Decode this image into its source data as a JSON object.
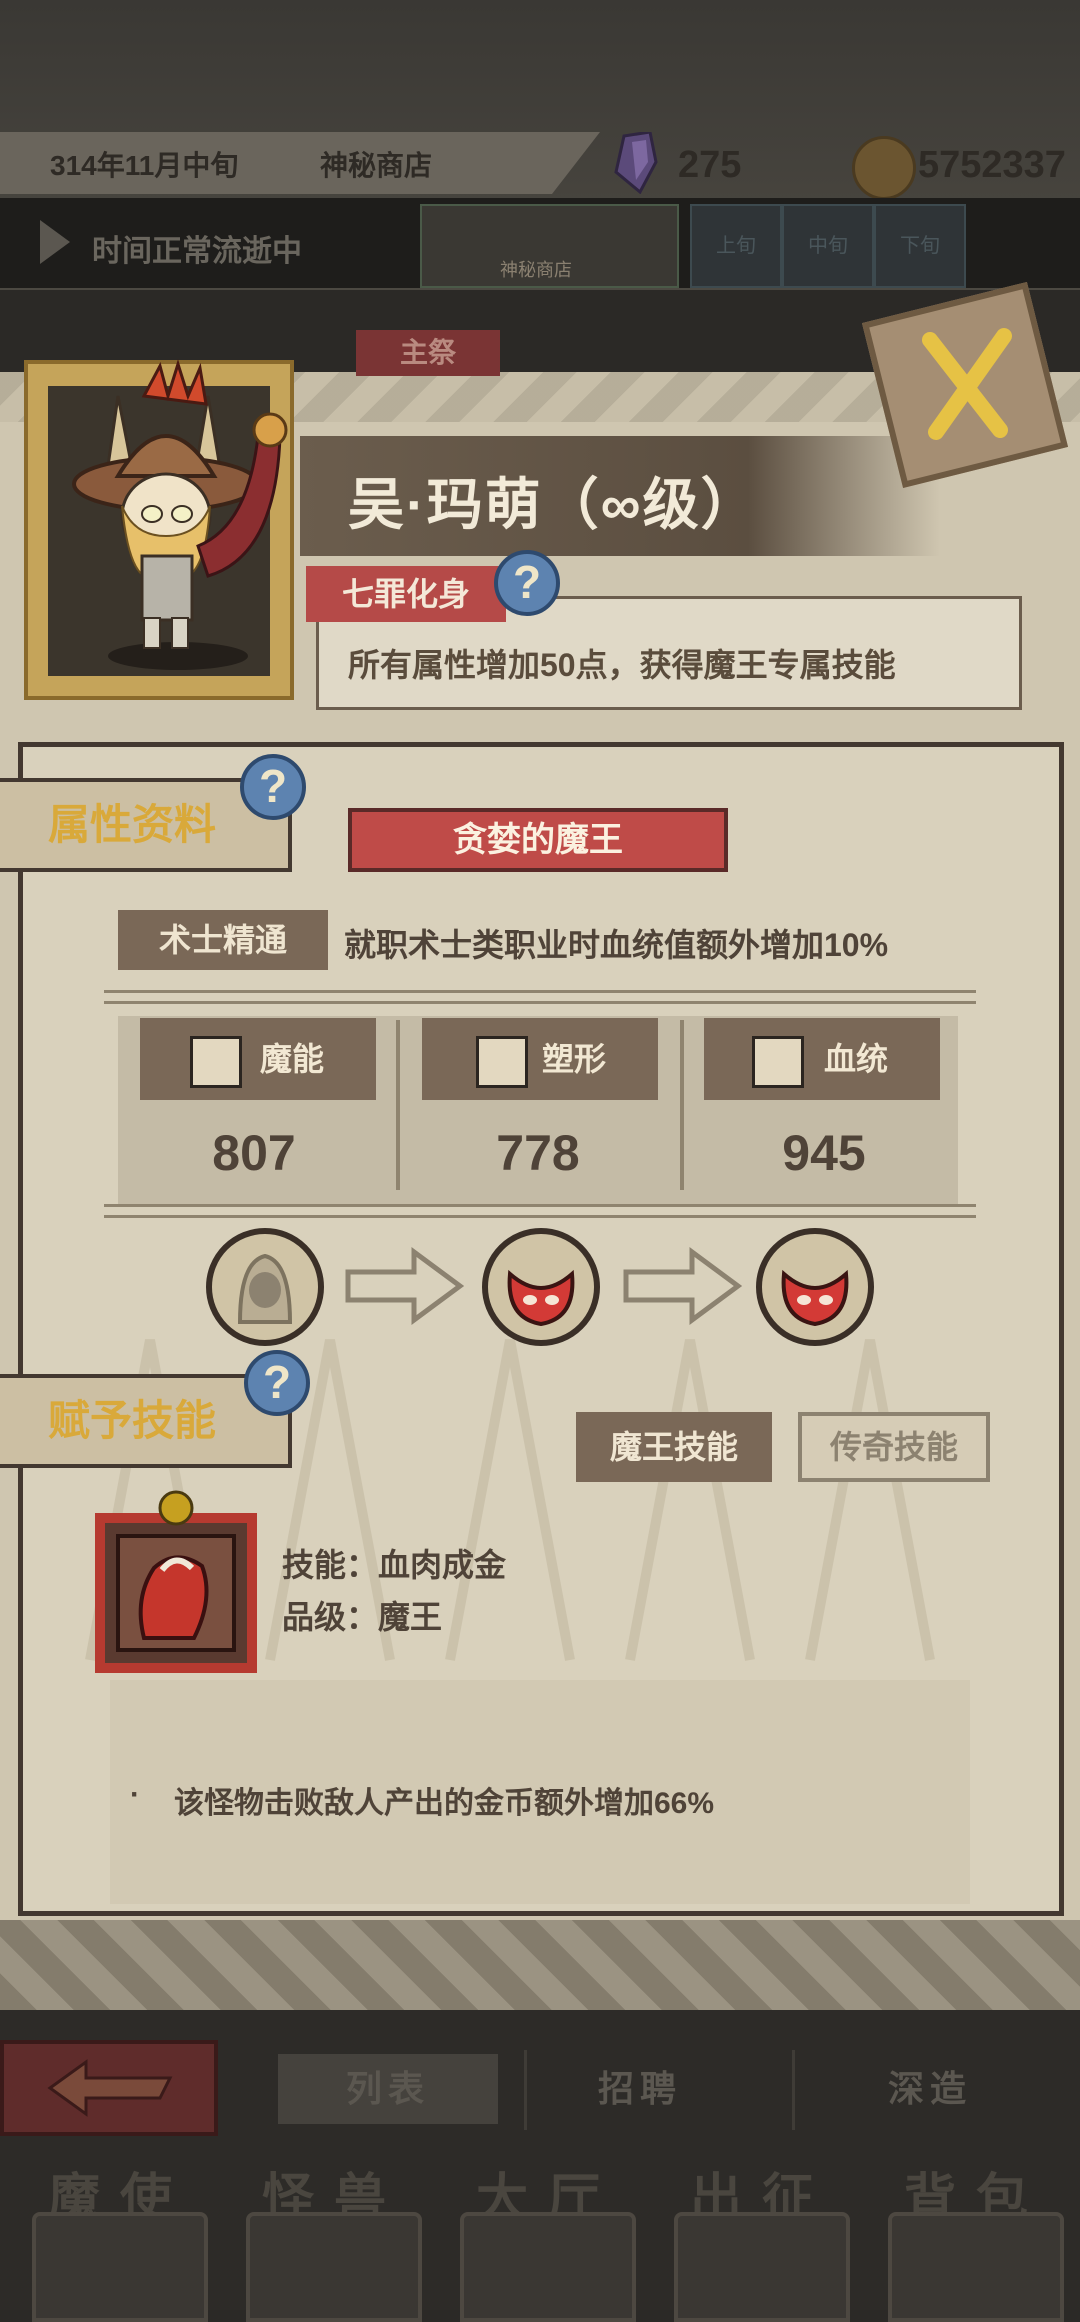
{
  "status_bar": {
    "date": "314年11月中旬",
    "location": "神秘商店",
    "gems": "275",
    "gold": "5752337",
    "time_status": "时间正常流逝中",
    "thumbnail_label": "神秘商店",
    "periods": [
      "上旬",
      "中旬",
      "下旬"
    ]
  },
  "tag_main": "主祭",
  "character": {
    "name": "吴·玛萌（∞级）",
    "sin_title": "七罪化身",
    "sin_description": "所有属性增加50点，获得魔王专属技能"
  },
  "attributes": {
    "section_title": "属性资料",
    "class_title": "贪婪的魔王",
    "trait_name": "术士精通",
    "trait_description": "就职术士类职业时血统值额外增加10%",
    "stats": [
      {
        "label": "魔能",
        "value": "807",
        "icon": "magic-icon"
      },
      {
        "label": "塑形",
        "value": "778",
        "icon": "shape-icon"
      },
      {
        "label": "血统",
        "value": "945",
        "icon": "bloodline-icon"
      }
    ]
  },
  "skills": {
    "section_title": "赋予技能",
    "tab_demon": "魔王技能",
    "tab_legend": "传奇技能",
    "skill_name_line": "技能：血肉成金",
    "skill_grade_line": "品级：魔王",
    "bullet": "·",
    "effect": "该怪物击败敌人产出的金币额外增加66%"
  },
  "bottom": {
    "tabs": [
      "列表",
      "招聘",
      "深造"
    ],
    "nav": [
      "魔使",
      "怪兽",
      "大厅",
      "出征",
      "背包"
    ]
  },
  "colors": {
    "banner_red": "#bf4b48",
    "parchment": "#d9d1bc",
    "section_gold": "#d9a93a",
    "help_blue": "#5d83b0"
  }
}
